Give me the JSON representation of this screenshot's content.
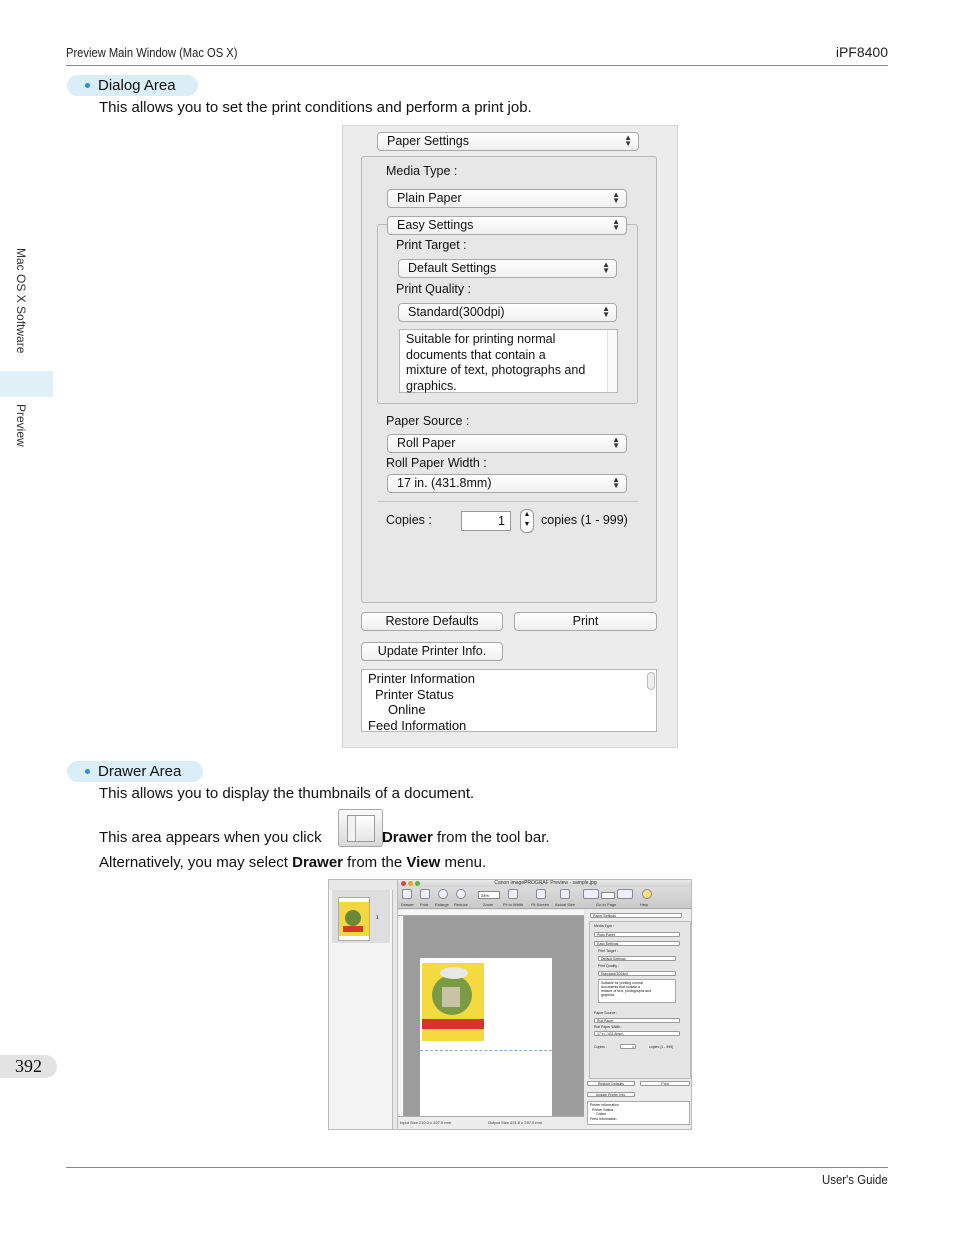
{
  "header": {
    "section": "Preview Main Window (Mac OS X)",
    "model": "iPF8400"
  },
  "footer": {
    "guide": "User's Guide"
  },
  "sidebar": {
    "chapter": "Mac OS X Software",
    "sub": "Preview",
    "page_number": "392"
  },
  "dialog_area": {
    "heading": "Dialog Area",
    "description": "This allows you to set the print conditions and perform a print job."
  },
  "dialog": {
    "top_select": "Paper Settings",
    "media_type_label": "Media Type :",
    "media_type_value": "Plain Paper",
    "mode_value": "Easy Settings",
    "print_target_label": "Print Target :",
    "print_target_value": "Default Settings",
    "print_quality_label": "Print Quality :",
    "print_quality_value": "Standard(300dpi)",
    "quality_description": [
      "Suitable for printing normal",
      "documents that contain a",
      "mixture of text, photographs and",
      "graphics."
    ],
    "paper_source_label": "Paper Source :",
    "paper_source_value": "Roll Paper",
    "roll_width_label": "Roll Paper Width :",
    "roll_width_value": "17 in. (431.8mm)",
    "copies_label": "Copies :",
    "copies_value": "1",
    "copies_range": "copies (1 - 999)",
    "restore_button": "Restore Defaults",
    "print_button": "Print",
    "update_button": "Update Printer Info.",
    "info_lines": [
      "Printer Information",
      "Printer Status",
      "Online",
      "Feed Information"
    ]
  },
  "drawer_area": {
    "heading": "Drawer Area",
    "description": "This allows you to display the thumbnails of a document.",
    "line1_before": "This area appears when you click",
    "line1_bold": "Drawer",
    "line1_after": "from the tool bar.",
    "line2_before": "Alternatively, you may select",
    "line2_bold1": "Drawer",
    "line2_mid": "from the",
    "line2_bold2": "View",
    "line2_after": "menu."
  },
  "screenshot": {
    "window_title": "Canon imagePROGRAF Preview - sample.jpg",
    "thumbnail_number": "1",
    "toolbar_labels": [
      "Drawer",
      "Print",
      "Enlarge",
      "Reduce",
      "Zoom",
      "Fit to Width",
      "Fit Screen",
      "Actual Size",
      "Go to Page",
      "Help"
    ],
    "zoom_value": "28%",
    "input_size": "Input Size 210.0 x 297.0 mm",
    "output_size": "Output Size 431.8 x 297.0 mm"
  },
  "colors": {
    "pill": "#d9eef7",
    "bullet": "#2a8fd6",
    "dialog_bg": "#ececec"
  }
}
